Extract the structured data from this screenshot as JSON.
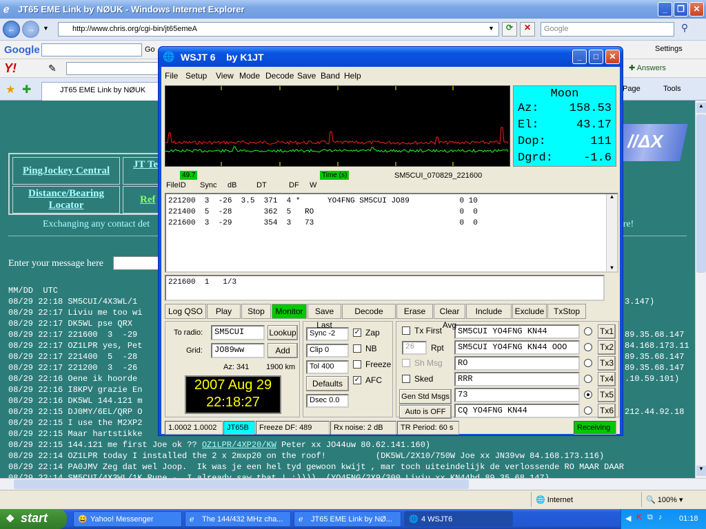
{
  "ie": {
    "title": "JT65 EME Link by NØUK - Windows Internet Explorer",
    "url": "http://www.chris.org/cgi-bin/jt65emeA",
    "search_placeholder": "Google",
    "tab_label": "JT65 EME Link by NØUK",
    "google_label": "Google",
    "go_label": "Go",
    "settings": "Settings",
    "answers": "Answers",
    "page": "Page",
    "tools": "Tools",
    "status_zone": "Internet",
    "zoom": "100%"
  },
  "page": {
    "links": [
      "PingJockey Central",
      "Distance/Bearing Locator",
      "JT Terre",
      "Ref"
    ],
    "info": "Exchanging any contact det",
    "info_right": "g here!",
    "enter_msg": "Enter your message here",
    "header": "MM/DD  UTC",
    "log_left": [
      "08/29 22:18 SM5CUI/4X3WL/1",
      "08/29 22:17 Liviu me too wi",
      "08/29 22:17 DK5WL pse QRX",
      "08/29 22:17 221600  3  -29",
      "08/29 22:17 OZ1LPR yes, Pet",
      "08/29 22:17 221400  5  -28",
      "08/29 22:17 221200  3  -26",
      "08/29 22:16 Oene ik hoorde",
      "08/29 22:16 I8KPV grazie En",
      "08/29 22:16 DK5WL 144.121 m",
      "08/29 22:15 DJ0MY/6EL/QRP O",
      "08/29 22:15 I use the M2XP2",
      "08/29 22:15 Maar hartstikke"
    ],
    "log_right": [
      "3.147)",
      "",
      "",
      "89.35.68.147",
      "84.168.173.11",
      "89.35.68.147",
      "89.35.68.147",
      ".10.59.101)",
      "",
      "",
      "212.44.92.18",
      "",
      ""
    ],
    "log_full": [
      {
        "prefix": "08/29 22:15 144.121 me first Joe ok ?? ",
        "link": "OZ1LPR/4XP20/KW",
        "suffix": " Peter xx JO44uw 80.62.141.160)"
      },
      {
        "prefix": "08/29 22:14 OZ1LPR today I installed the 2 x 2mxp20 on the roof!          (DK5WL/2X10/750W Joe xx JN39vw 84.168.173.116)",
        "link": "",
        "suffix": ""
      },
      {
        "prefix": "08/29 22:14 PA0JMV Zeg dat wel Joop.  Ik was je een hel tyd gewoon kwijt , mar toch uiteindelijk de verlossende RO MAAR DAAR",
        "link": "",
        "suffix": ""
      },
      {
        "prefix": "08/29 22:14 SM5CUI/4X3WL/1K Rune -  I already saw that ! :))))  (YO4FNG/2X9/300 Liviu xx KN44hd 89.35.68.147)",
        "link": "",
        "suffix": ""
      }
    ]
  },
  "wsjt": {
    "title": "WSJT 6    by K1JT",
    "menu": [
      "File",
      "Setup",
      "View",
      "Mode",
      "Decode",
      "Save",
      "Band",
      "Help"
    ],
    "moon": {
      "title": "Moon",
      "rows": [
        {
          "k": "Az:",
          "v": "158.53"
        },
        {
          "k": "El:",
          "v": "43.17"
        },
        {
          "k": "Dop:",
          "v": "111"
        },
        {
          "k": "Dgrd:",
          "v": "-1.6"
        }
      ]
    },
    "freq_label": "49.7",
    "time_label": "Time (s)",
    "file_label": "SM5CUI_070829_221600",
    "cols": [
      "FileID",
      "Sync",
      "dB",
      "DT",
      "DF",
      "W"
    ],
    "decodes": [
      "221200  3  -26  3.5  371  4 *      YO4FNG SM5CUI JO89           0 10",
      "221400  5  -28       362  5   RO                                0  0",
      "221600  3  -29       354  3   73                                0  0"
    ],
    "decode2": "221600  1   1/3",
    "buttons": [
      "Log QSO",
      "Play",
      "Stop",
      "Monitor",
      "Save Last",
      "Decode",
      "Erase",
      "Clear Avg",
      "Include",
      "Exclude",
      "TxStop"
    ],
    "to_radio_label": "To radio:",
    "to_radio": "SM5CUI",
    "lookup": "Lookup",
    "grid_label": "Grid:",
    "grid": "JO89ww",
    "add": "Add",
    "az": "Az: 341",
    "km": "1900 km",
    "date": "2007 Aug 29",
    "time": "22:18:27",
    "sync": "Sync  -2",
    "clip": "Clip   0",
    "tol": "Tol   400",
    "defaults": "Defaults",
    "dsec": "Dsec  0.0",
    "checks": [
      {
        "label": "Zap",
        "on": true
      },
      {
        "label": "NB",
        "on": false
      },
      {
        "label": "Freeze",
        "on": false
      },
      {
        "label": "AFC",
        "on": true
      }
    ],
    "txfirst": "Tx First",
    "rpt_val": "26",
    "rpt": "Rpt",
    "shmsg": "Sh Msg",
    "sked": "Sked",
    "genstd": "Gen Std Msgs",
    "autooff": "Auto is OFF",
    "tx": [
      {
        "msg": "SM5CUI YO4FNG KN44",
        "btn": "Tx1",
        "sel": false
      },
      {
        "msg": "SM5CUI YO4FNG KN44 OOO",
        "btn": "Tx2",
        "sel": false
      },
      {
        "msg": "RO",
        "btn": "Tx3",
        "sel": false
      },
      {
        "msg": "RRR",
        "btn": "Tx4",
        "sel": false
      },
      {
        "msg": "73",
        "btn": "Tx5",
        "sel": true
      },
      {
        "msg": "CQ YO4FNG KN44",
        "btn": "Tx6",
        "sel": false
      }
    ],
    "status": {
      "ver": "1.0002 1.0002",
      "mode": "JT65B",
      "freeze": "Freeze DF: 489",
      "rxnoise": "Rx noise:  2 dB",
      "tr": "TR Period: 60 s",
      "state": "Receiving"
    }
  },
  "taskbar": {
    "start": "start",
    "tasks": [
      "Yahoo! Messenger",
      "The 144/432 MHz cha...",
      "JT65 EME Link by NØ...",
      "4 WSJT6"
    ],
    "clock": "01:18"
  },
  "colors": {
    "page_bg": "#2c7c7a",
    "moon_bg": "#00ffff",
    "green": "#00c800",
    "mode_bg": "#00ffff"
  }
}
